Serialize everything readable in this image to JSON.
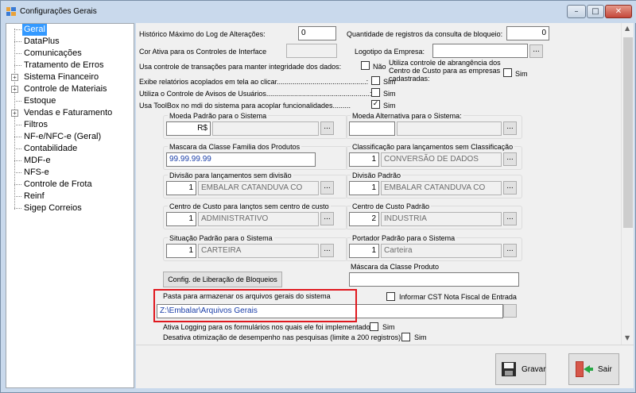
{
  "window": {
    "title": "Configurações Gerais",
    "min": "–",
    "max": "□",
    "close": "✕"
  },
  "tree": {
    "items": [
      {
        "label": "Geral"
      },
      {
        "label": "DataPlus"
      },
      {
        "label": "Comunicações"
      },
      {
        "label": "Tratamento de Erros"
      },
      {
        "label": "Sistema Financeiro"
      },
      {
        "label": "Controle de Materiais"
      },
      {
        "label": "Estoque"
      },
      {
        "label": "Vendas e Faturamento"
      },
      {
        "label": "Filtros"
      },
      {
        "label": "NF-e/NFC-e (Geral)"
      },
      {
        "label": "Contabilidade"
      },
      {
        "label": "MDF-e"
      },
      {
        "label": "NFS-e"
      },
      {
        "label": "Controle de Frota"
      },
      {
        "label": "Reinf"
      },
      {
        "label": "Sigep Correios"
      }
    ]
  },
  "form": {
    "historico_label": "Histórico Máximo do Log de Alterações:",
    "historico_value": "0",
    "qtd_bloqueio_label": "Quantidade de registros da consulta de bloqueio:",
    "qtd_bloqueio_value": "0",
    "cor_ativa_label": "Cor Ativa para os Controles de Interface",
    "logotipo_label": "Logotipo da Empresa:",
    "transacoes_label": "Usa controle de transações para manter integridade dos dados:",
    "transacoes_value": "Não",
    "abrangencia_label": "Utiliza controle de abrangência dos Centro de Custo para as empresas cadastradas:",
    "abrangencia_value": "Sim",
    "relatorios_label": "Exibe relatórios acoplados em tela ao clicar.............................................:",
    "relatorios_value": "Sim",
    "avisos_label": "Utiliza o Controle de Avisos de Usuários....................................................:",
    "avisos_value": "Sim",
    "toolbox_label": "Usa ToolBox no mdi do sistema para acoplar funcionalidades.........",
    "toolbox_value": "Sim",
    "moeda_padrao_label": "Moeda Padrão para o Sistema",
    "moeda_padrao_value": "R$",
    "moeda_alt_label": "Moeda Alternativa para o Sistema:",
    "mascara_familia_label": "Mascara da Classe Familia dos Produtos",
    "mascara_familia_value": "99.99.99.99",
    "classificacao_label": "Classificação para lançamentos sem Classificação",
    "classificacao_code": "1",
    "classificacao_value": "CONVERSÃO DE DADOS",
    "divisao_sem_label": "Divisão para lançamentos sem divisão",
    "divisao_sem_code": "1",
    "divisao_sem_value": "EMBALAR CATANDUVA CO",
    "divisao_padrao_label": "Divisão Padrão",
    "divisao_padrao_code": "1",
    "divisao_padrao_value": "EMBALAR CATANDUVA CO",
    "centro_sem_label": "Centro de Custo para lançtos sem centro de custo",
    "centro_sem_code": "1",
    "centro_sem_value": "ADMINISTRATIVO",
    "centro_padrao_label": "Centro de Custo Padrão",
    "centro_padrao_code": "2",
    "centro_padrao_value": "INDUSTRIA",
    "situacao_label": "Situação Padrão para o Sistema",
    "situacao_code": "1",
    "situacao_value": "CARTEIRA",
    "portador_label": "Portador Padrão para o Sistema",
    "portador_code": "1",
    "portador_value": "Carteira",
    "mascara_produto_label": "Máscara da Classe Produto",
    "liberacao_button": "Config. de Liberação de Bloqueios",
    "pasta_label": "Pasta para armazenar os arquivos gerais do sistema",
    "pasta_value": "Z:\\Embalar\\Arquivos Gerais",
    "cst_label": "Informar CST Nota Fiscal de Entrada",
    "logging_label": "Ativa Logging para os formulários nos quais ele foi implementado:",
    "logging_value": "Sim",
    "otimizacao_label": "Desativa otimização de desempenho nas pesquisas (limite a 200 registros):",
    "otimizacao_value": "Sim",
    "ellipsis": "..."
  },
  "actions": {
    "gravar": "Gravar",
    "sair": "Sair"
  },
  "colors": {
    "highlight": "#e0181e",
    "selection": "#3399ff"
  }
}
